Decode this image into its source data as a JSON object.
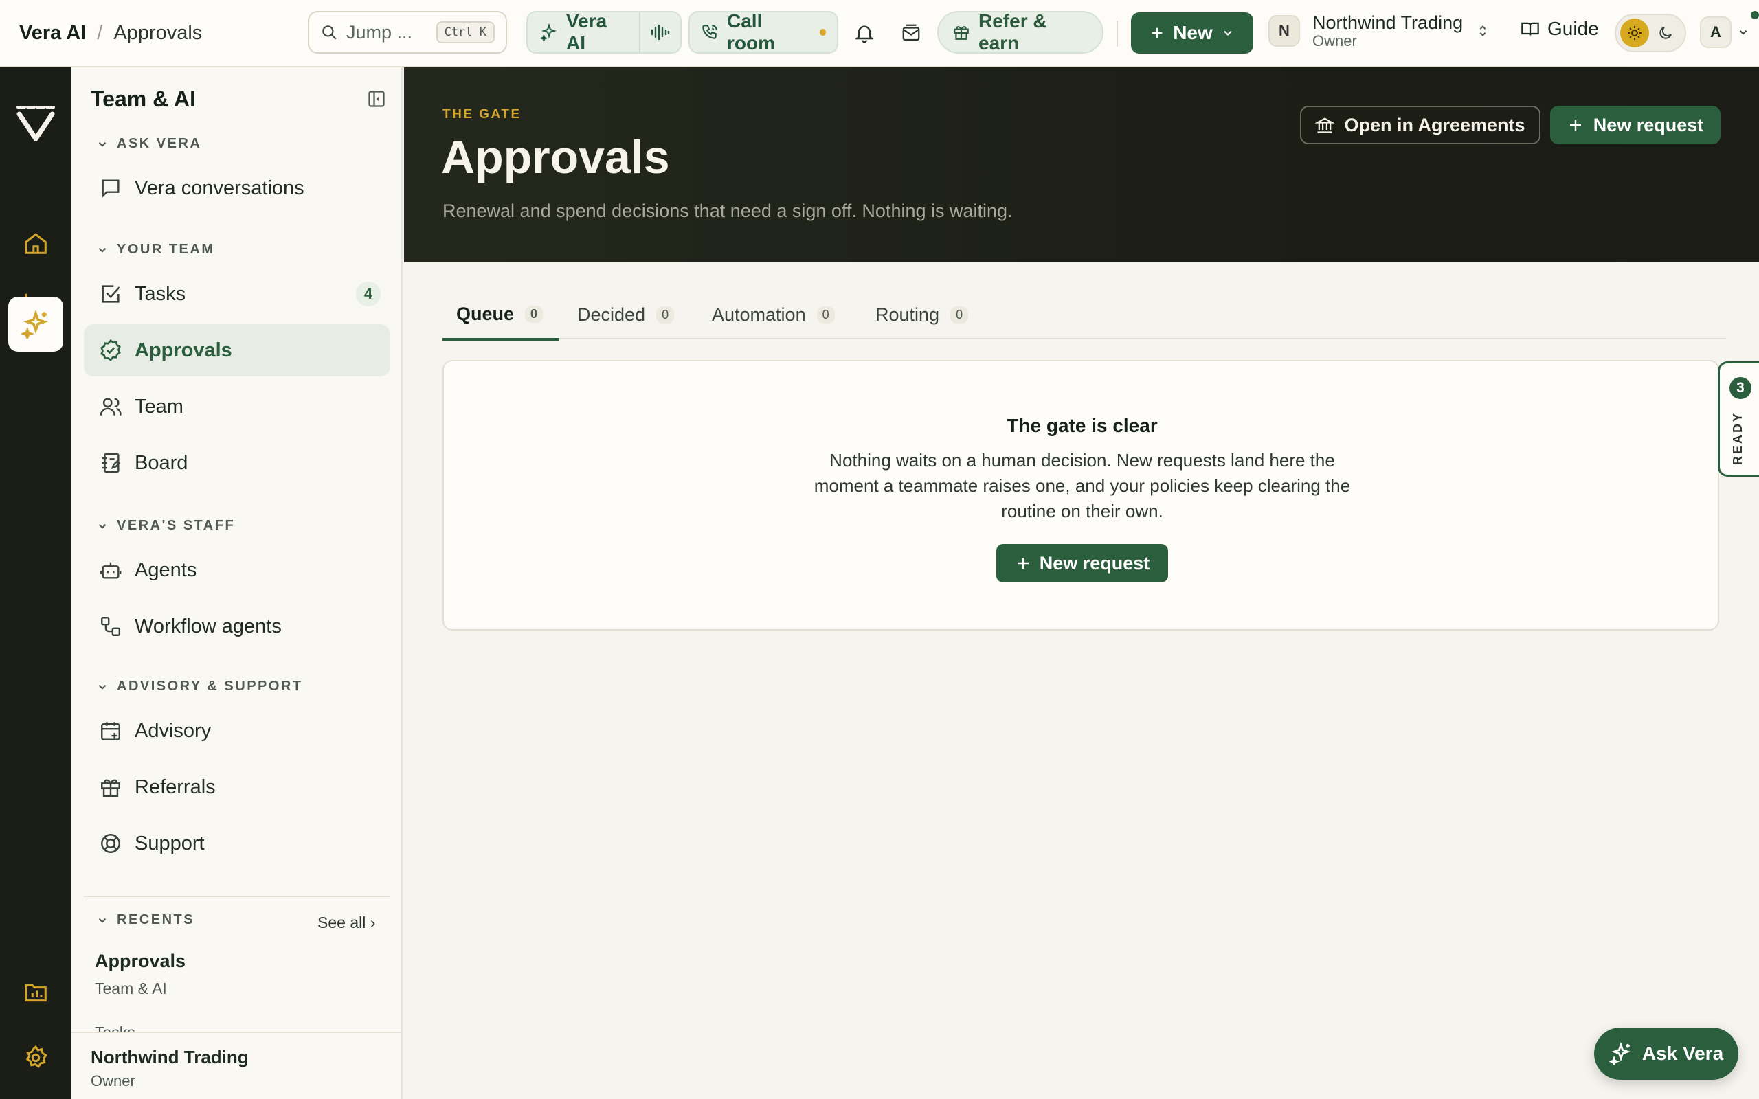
{
  "topbar": {
    "breadcrumb_app": "Vera AI",
    "breadcrumb_sep": "/",
    "breadcrumb_current": "Approvals",
    "search_placeholder": "Jump ...",
    "search_shortcut": "Ctrl K",
    "vera_ai_label": "Vera AI",
    "call_room_label": "Call room",
    "refer_label": "Refer & earn",
    "new_label": "New",
    "org_initial": "N",
    "org_name": "Northwind Trading",
    "org_role": "Owner",
    "guide_label": "Guide",
    "user_initial": "A"
  },
  "sidebar": {
    "title": "Team & AI",
    "sections": {
      "ask_vera": "ASK VERA",
      "your_team": "YOUR TEAM",
      "veras_staff": "VERA'S STAFF",
      "advisory": "ADVISORY & SUPPORT",
      "recents": "RECENTS"
    },
    "items": {
      "vera_conversations": "Vera conversations",
      "tasks": "Tasks",
      "tasks_badge": "4",
      "approvals": "Approvals",
      "team": "Team",
      "board": "Board",
      "agents": "Agents",
      "workflow_agents": "Workflow agents",
      "advisory": "Advisory",
      "referrals": "Referrals",
      "support": "Support"
    },
    "see_all": "See all ›",
    "recent_title": "Approvals",
    "recent_sub": "Team & AI",
    "recent_next": "Tasks",
    "footer_name": "Northwind Trading",
    "footer_role": "Owner"
  },
  "hero": {
    "eyebrow": "THE GATE",
    "title": "Approvals",
    "subtitle": "Renewal and spend decisions that need a sign off. Nothing is waiting.",
    "open_agreements": "Open in Agreements",
    "new_request": "New request"
  },
  "tabs": [
    {
      "label": "Queue",
      "count": "0"
    },
    {
      "label": "Decided",
      "count": "0"
    },
    {
      "label": "Automation",
      "count": "0"
    },
    {
      "label": "Routing",
      "count": "0"
    }
  ],
  "empty": {
    "title": "The gate is clear",
    "body": "Nothing waits on a human decision. New requests land here the moment a teammate raises one, and your policies keep clearing the routine on their own.",
    "button": "New request"
  },
  "ready": {
    "count": "3",
    "label": "READY"
  },
  "fab": {
    "label": "Ask Vera"
  },
  "colors": {
    "brand_green": "#2a5e3c",
    "accent_amber": "#d4a52c",
    "rail_dark": "#1b1d17"
  }
}
